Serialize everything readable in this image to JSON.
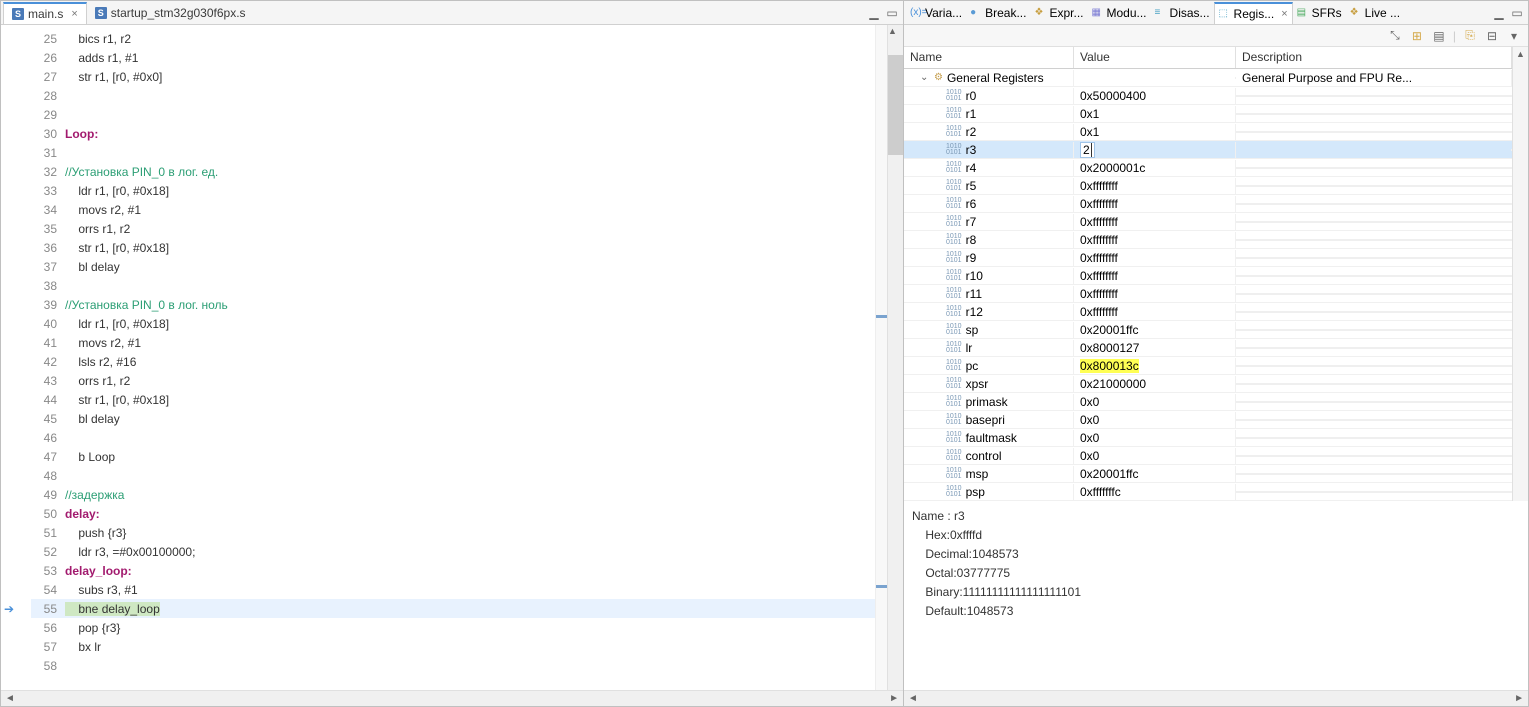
{
  "editor": {
    "tabs": [
      {
        "label": "main.s",
        "iconLetter": "S",
        "active": true
      },
      {
        "label": "startup_stm32g030f6px.s",
        "iconLetter": "S",
        "active": false
      }
    ],
    "currentLine": 55,
    "lines": [
      {
        "n": 25,
        "t": "    bics r1, r2"
      },
      {
        "n": 26,
        "t": "    adds r1, #1"
      },
      {
        "n": 27,
        "t": "    str r1, [r0, #0x0]"
      },
      {
        "n": 28,
        "t": ""
      },
      {
        "n": 29,
        "t": ""
      },
      {
        "n": 30,
        "label": "Loop:"
      },
      {
        "n": 31,
        "t": ""
      },
      {
        "n": 32,
        "comment": "//Установка PIN_0 в лог. ед."
      },
      {
        "n": 33,
        "t": "    ldr r1, [r0, #0x18]"
      },
      {
        "n": 34,
        "t": "    movs r2, #1"
      },
      {
        "n": 35,
        "t": "    orrs r1, r2"
      },
      {
        "n": 36,
        "t": "    str r1, [r0, #0x18]"
      },
      {
        "n": 37,
        "t": "    bl delay"
      },
      {
        "n": 38,
        "t": ""
      },
      {
        "n": 39,
        "comment": "//Установка PIN_0 в лог. ноль"
      },
      {
        "n": 40,
        "t": "    ldr r1, [r0, #0x18]"
      },
      {
        "n": 41,
        "t": "    movs r2, #1"
      },
      {
        "n": 42,
        "t": "    lsls r2, #16"
      },
      {
        "n": 43,
        "t": "    orrs r1, r2"
      },
      {
        "n": 44,
        "t": "    str r1, [r0, #0x18]"
      },
      {
        "n": 45,
        "t": "    bl delay"
      },
      {
        "n": 46,
        "t": ""
      },
      {
        "n": 47,
        "t": "    b Loop"
      },
      {
        "n": 48,
        "t": ""
      },
      {
        "n": 49,
        "comment": "//задержка"
      },
      {
        "n": 50,
        "label": "delay:"
      },
      {
        "n": 51,
        "t": "    push {r3}"
      },
      {
        "n": 52,
        "t": "    ldr r3, =#0x00100000;"
      },
      {
        "n": 53,
        "label": "delay_loop:"
      },
      {
        "n": 54,
        "t": "    subs r3, #1"
      },
      {
        "n": 55,
        "t": "    bne delay_loop",
        "hl": "yellow"
      },
      {
        "n": 56,
        "t": "    pop {r3}"
      },
      {
        "n": 57,
        "t": "    bx lr"
      },
      {
        "n": 58,
        "t": ""
      }
    ]
  },
  "rightTabs": [
    {
      "label": "Varia...",
      "icon": "(x)=",
      "color": "#4a90d9"
    },
    {
      "label": "Break...",
      "icon": "●",
      "color": "#5a9bd5"
    },
    {
      "label": "Expr...",
      "icon": "❖",
      "color": "#c79e3f"
    },
    {
      "label": "Modu...",
      "icon": "▦",
      "color": "#7a7ad4"
    },
    {
      "label": "Disas...",
      "icon": "≡",
      "color": "#4aa2c4"
    },
    {
      "label": "Regis...",
      "icon": "⬚",
      "color": "#4aa2c4",
      "active": true
    },
    {
      "label": "SFRs",
      "icon": "▤",
      "color": "#4bab60"
    },
    {
      "label": "Live ...",
      "icon": "❖",
      "color": "#c79e3f"
    }
  ],
  "registers": {
    "columns": {
      "name": "Name",
      "value": "Value",
      "desc": "Description"
    },
    "groupLabel": "General Registers",
    "groupDesc": "General Purpose and FPU Re...",
    "selectedRow": "r3",
    "editingValue": "2",
    "changedRow": "pc",
    "rows": [
      {
        "name": "r0",
        "value": "0x50000400"
      },
      {
        "name": "r1",
        "value": "0x1"
      },
      {
        "name": "r2",
        "value": "0x1"
      },
      {
        "name": "r3",
        "value": "2",
        "editing": true,
        "selected": true
      },
      {
        "name": "r4",
        "value": "0x2000001c"
      },
      {
        "name": "r5",
        "value": "0xffffffff"
      },
      {
        "name": "r6",
        "value": "0xffffffff"
      },
      {
        "name": "r7",
        "value": "0xffffffff"
      },
      {
        "name": "r8",
        "value": "0xffffffff"
      },
      {
        "name": "r9",
        "value": "0xffffffff"
      },
      {
        "name": "r10",
        "value": "0xffffffff"
      },
      {
        "name": "r11",
        "value": "0xffffffff"
      },
      {
        "name": "r12",
        "value": "0xffffffff"
      },
      {
        "name": "sp",
        "value": "0x20001ffc"
      },
      {
        "name": "lr",
        "value": "0x8000127"
      },
      {
        "name": "pc",
        "value": "0x800013c",
        "changed": true
      },
      {
        "name": "xpsr",
        "value": "0x21000000"
      },
      {
        "name": "primask",
        "value": "0x0"
      },
      {
        "name": "basepri",
        "value": "0x0"
      },
      {
        "name": "faultmask",
        "value": "0x0"
      },
      {
        "name": "control",
        "value": "0x0"
      },
      {
        "name": "msp",
        "value": "0x20001ffc"
      },
      {
        "name": "psp",
        "value": "0xfffffffc"
      }
    ]
  },
  "detail": {
    "lines": [
      "Name : r3",
      "    Hex:0xffffd",
      "    Decimal:1048573",
      "    Octal:03777775",
      "    Binary:11111111111111111101",
      "    Default:1048573"
    ]
  }
}
